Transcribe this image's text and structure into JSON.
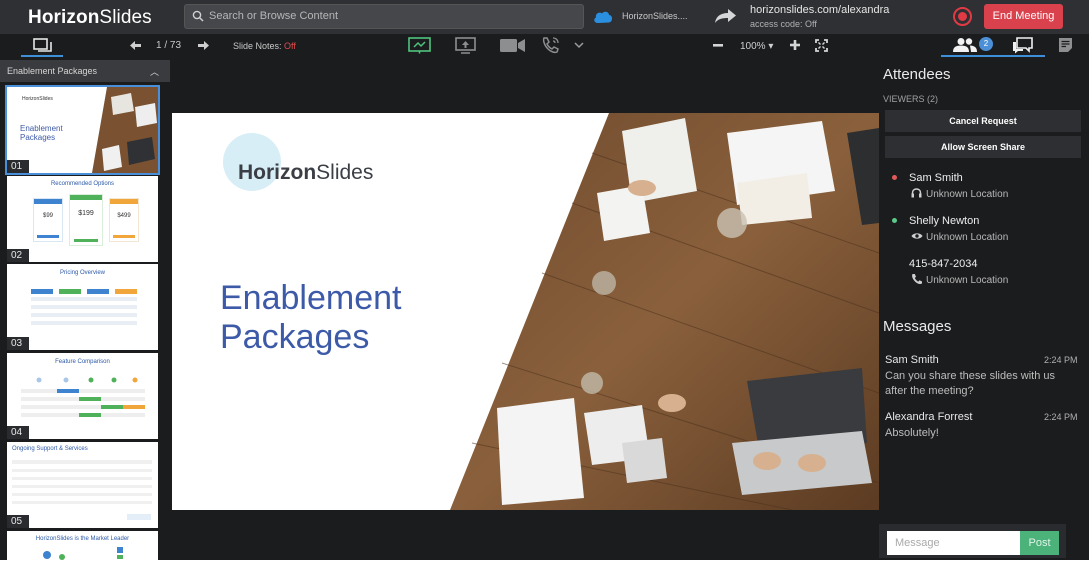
{
  "app": {
    "logo_bold": "Horizon",
    "logo_light": "Slides"
  },
  "topbar": {
    "search_placeholder": "Search or Browse Content",
    "salesforce_label": "HorizonSlides....",
    "url": "horizonslides.com/alexandra",
    "access_code": "access code: Off",
    "end_meeting": "End Meeting"
  },
  "toolbar": {
    "page_indicator": "1 / 73",
    "slide_notes_label": "Slide Notes: ",
    "slide_notes_value": "Off",
    "zoom": "100%",
    "attendee_badge": "2"
  },
  "left_panel": {
    "header": "Enablement Packages",
    "thumbnails": [
      {
        "num": "01",
        "title": "Enablement Packages"
      },
      {
        "num": "02",
        "title": "Recommended Options"
      },
      {
        "num": "03",
        "title": "Pricing Overview"
      },
      {
        "num": "04",
        "title": "Feature Comparison"
      },
      {
        "num": "05",
        "title": "Ongoing Support & Services"
      },
      {
        "num": "06",
        "title": "HorizonSlides is the Market Leader"
      }
    ],
    "prices": [
      "$99",
      "$199",
      "$499"
    ]
  },
  "slide": {
    "logo_bold": "Horizon",
    "logo_light": "Slides",
    "title_line1": "Enablement",
    "title_line2": "Packages"
  },
  "attendees": {
    "title": "Attendees",
    "viewers": "VIEWERS (2)",
    "cancel_request": "Cancel Request",
    "allow_screen_share": "Allow Screen Share",
    "list": [
      {
        "name": "Sam Smith",
        "location": "Unknown Location",
        "status_color": "#e05a5a",
        "icon": "headphones-icon"
      },
      {
        "name": "Shelly Newton",
        "location": "Unknown Location",
        "status_color": "#5cc88a",
        "icon": "eye-icon"
      },
      {
        "name": "415-847-2034",
        "location": "Unknown Location",
        "icon": "phone-icon"
      }
    ]
  },
  "messages": {
    "title": "Messages",
    "list": [
      {
        "sender": "Sam Smith",
        "time": "2:24 PM",
        "text": "Can you share these slides with us after the meeting?"
      },
      {
        "sender": "Alexandra Forrest",
        "time": "2:24 PM",
        "text": "Absolutely!"
      }
    ],
    "input_placeholder": "Message",
    "post": "Post"
  },
  "colors": {
    "accent": "#3f8fd8",
    "end_meeting": "#d9414d",
    "post": "#4bb27a",
    "slide_title": "#3d5aa8"
  }
}
